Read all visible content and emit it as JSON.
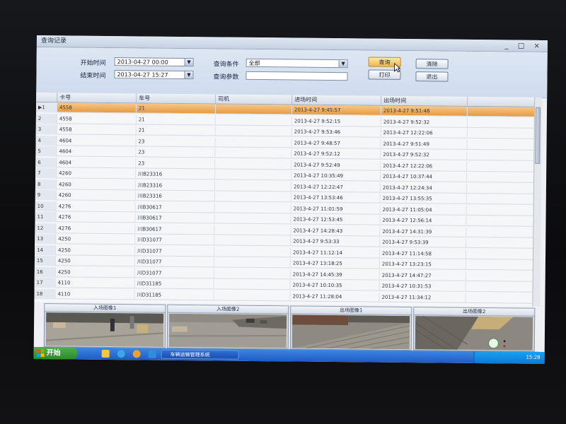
{
  "window": {
    "title": "查询记录",
    "buttons": "_ □ ×"
  },
  "query": {
    "start_label": "开始时间",
    "start_value": "2013-04-27 00:00",
    "end_label": "结束时间",
    "end_value": "2013-04-27 15:27",
    "condition_label": "查询条件",
    "condition_value": "全部",
    "param_label": "查询参数",
    "param_value": "",
    "search_button": "查询",
    "clear_button": "清除",
    "print_button": "打印",
    "exit_button": "退出"
  },
  "table": {
    "columns": [
      "卡号",
      "车号",
      "司机",
      "进场时间",
      "出场时间"
    ],
    "rows": [
      {
        "idx": "▶1",
        "card": "4558",
        "plate": "21",
        "driver": "",
        "in": "2013-4-27 9:45:57",
        "out": "2013-4-27 9:51:48"
      },
      {
        "idx": "2",
        "card": "4558",
        "plate": "21",
        "driver": "",
        "in": "2013-4-27 9:52:15",
        "out": "2013-4-27 9:52:32"
      },
      {
        "idx": "3",
        "card": "4558",
        "plate": "21",
        "driver": "",
        "in": "2013-4-27 9:53:46",
        "out": "2013-4-27 12:22:06"
      },
      {
        "idx": "4",
        "card": "4604",
        "plate": "23",
        "driver": "",
        "in": "2013-4-27 9:48:57",
        "out": "2013-4-27 9:51:49"
      },
      {
        "idx": "5",
        "card": "4604",
        "plate": "23",
        "driver": "",
        "in": "2013-4-27 9:52:12",
        "out": "2013-4-27 9:52:32"
      },
      {
        "idx": "6",
        "card": "4604",
        "plate": "23",
        "driver": "",
        "in": "2013-4-27 9:52:49",
        "out": "2013-4-27 12:22:06"
      },
      {
        "idx": "7",
        "card": "4260",
        "plate": "川B23316",
        "driver": "",
        "in": "2013-4-27 10:35:49",
        "out": "2013-4-27 10:37:44"
      },
      {
        "idx": "8",
        "card": "4260",
        "plate": "川B23316",
        "driver": "",
        "in": "2013-4-27 12:22:47",
        "out": "2013-4-27 12:24:34"
      },
      {
        "idx": "9",
        "card": "4260",
        "plate": "川B23316",
        "driver": "",
        "in": "2013-4-27 13:53:46",
        "out": "2013-4-27 13:55:35"
      },
      {
        "idx": "10",
        "card": "4276",
        "plate": "川B30617",
        "driver": "",
        "in": "2013-4-27 11:01:59",
        "out": "2013-4-27 11:05:04"
      },
      {
        "idx": "11",
        "card": "4276",
        "plate": "川B30617",
        "driver": "",
        "in": "2013-4-27 12:53:45",
        "out": "2013-4-27 12:56:14"
      },
      {
        "idx": "12",
        "card": "4276",
        "plate": "川B30617",
        "driver": "",
        "in": "2013-4-27 14:28:43",
        "out": "2013-4-27 14:31:39"
      },
      {
        "idx": "13",
        "card": "4250",
        "plate": "川D31077",
        "driver": "",
        "in": "2013-4-27 9:53:33",
        "out": "2013-4-27 9:53:39"
      },
      {
        "idx": "14",
        "card": "4250",
        "plate": "川D31077",
        "driver": "",
        "in": "2013-4-27 11:12:14",
        "out": "2013-4-27 11:14:58"
      },
      {
        "idx": "15",
        "card": "4250",
        "plate": "川D31077",
        "driver": "",
        "in": "2013-4-27 13:18:25",
        "out": "2013-4-27 13:23:15"
      },
      {
        "idx": "16",
        "card": "4250",
        "plate": "川D31077",
        "driver": "",
        "in": "2013-4-27 14:45:39",
        "out": "2013-4-27 14:47:27"
      },
      {
        "idx": "17",
        "card": "4110",
        "plate": "川D31185",
        "driver": "",
        "in": "2013-4-27 10:10:35",
        "out": "2013-4-27 10:31:53"
      },
      {
        "idx": "18",
        "card": "4110",
        "plate": "川D31185",
        "driver": "",
        "in": "2013-4-27 11:28:04",
        "out": "2013-4-27 11:34:12"
      }
    ]
  },
  "images": {
    "labels": [
      "入场图像1",
      "入场图像2",
      "出场图像1",
      "出场图像2"
    ]
  },
  "taskbar": {
    "start_label": "开始",
    "task_item": "车辆运输管理系统",
    "clock": "15:28"
  },
  "colors": {
    "selected_row": "#e89a3e",
    "accent_blue": "#1f5bc4"
  }
}
